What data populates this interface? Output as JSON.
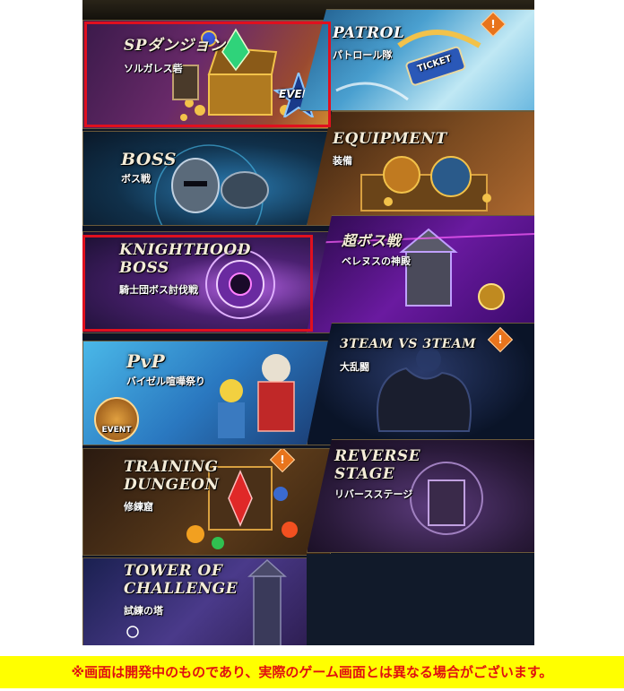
{
  "tiles": {
    "sp_dungeon": {
      "title": "SPダンジョン",
      "sub": "ソルガレス砦",
      "badge": "EVENT"
    },
    "patrol": {
      "title": "PATROL",
      "sub": "パトロール隊",
      "badge": "TICKET",
      "alert": "!"
    },
    "boss": {
      "title": "BOSS",
      "sub": "ボス戦"
    },
    "equipment": {
      "title": "EQUIPMENT",
      "sub": "装備"
    },
    "knighthood_boss": {
      "title_line1": "KNIGHTHOOD",
      "title_line2": "BOSS",
      "sub": "騎士団ボス討伐戦"
    },
    "super_boss": {
      "title": "超ボス戦",
      "sub": "ベレヌスの神殿"
    },
    "pvp": {
      "title": "PvP",
      "sub": "バイゼル喧嘩祭り",
      "badge": "EVENT"
    },
    "team_battle": {
      "title": "3TEAM VS 3TEAM",
      "sub": "大乱闘",
      "alert": "!"
    },
    "training_dungeon": {
      "title_line1": "TRAINING",
      "title_line2": "DUNGEON",
      "sub": "修練窟",
      "alert": "!"
    },
    "reverse_stage": {
      "title_line1": "REVERSE",
      "title_line2": "STAGE",
      "sub": "リバースステージ"
    },
    "tower": {
      "title_line1": "TOWER OF",
      "title_line2": "CHALLENGE",
      "sub": "試練の塔"
    }
  },
  "disclaimer": "※画面は開発中のものであり、実際のゲーム画面とは異なる場合がございます。",
  "colors": {
    "highlight": "#e0101e",
    "disclaimer_bg": "#ffff00",
    "disclaimer_text": "#e01010",
    "alert": "#e8741c"
  }
}
